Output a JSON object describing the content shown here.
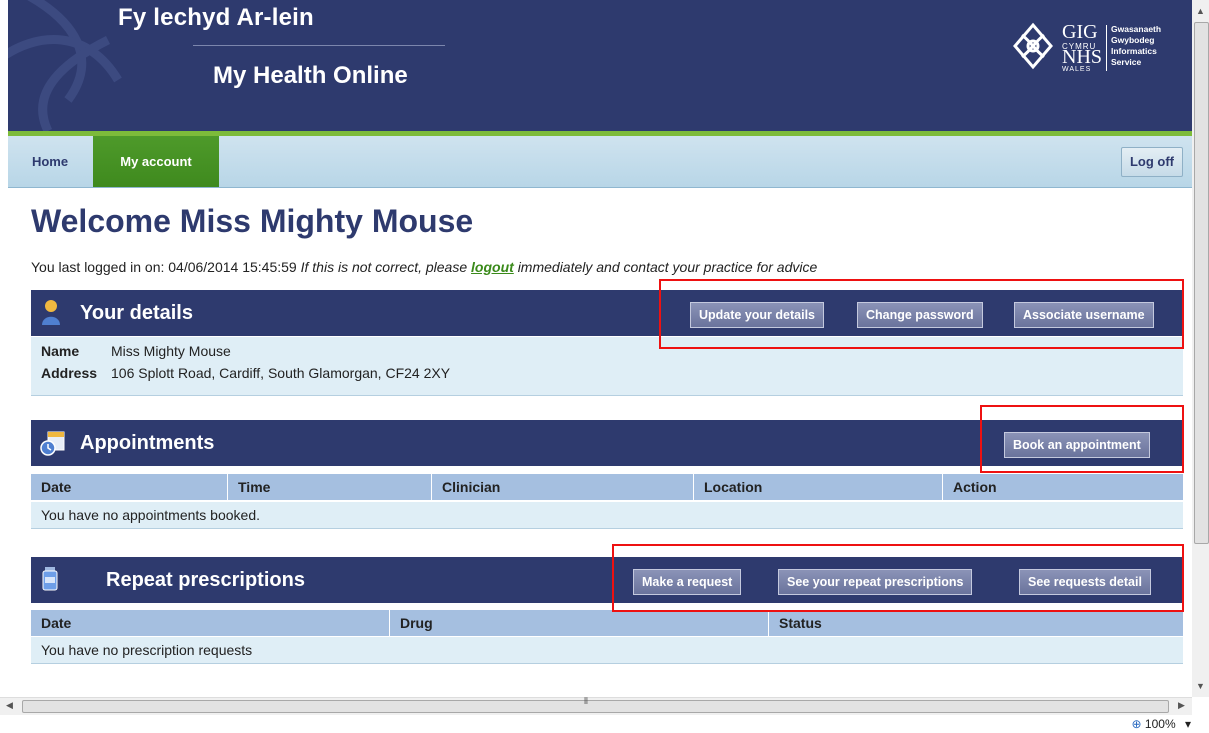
{
  "header": {
    "title_cy": "Fy lechyd Ar-lein",
    "title_en": "My Health Online",
    "logo": {
      "gig": "GIG",
      "cymru": "CYMRU",
      "nhs": "NHS",
      "wales": "WALES",
      "service_lines": [
        "Gwasanaeth",
        "Gwybodeg",
        "Informatics",
        "Service"
      ]
    }
  },
  "nav": {
    "tabs": [
      {
        "label": "Home",
        "active": false
      },
      {
        "label": "My account",
        "active": true
      }
    ],
    "logoff_label": "Log off"
  },
  "welcome": "Welcome Miss Mighty Mouse",
  "last_login": {
    "prefix": "You last logged in on: 04/06/2014 15:45:59",
    "notice_before": "If this is not correct, please",
    "logout_link": "logout",
    "notice_after": "immediately and contact your practice for advice"
  },
  "details": {
    "title": "Your details",
    "icon": "person-icon",
    "buttons": [
      "Update your details",
      "Change password",
      "Associate username"
    ],
    "name_label": "Name",
    "name_value": "Miss Mighty Mouse",
    "address_label": "Address",
    "address_value": "106 Splott Road, Cardiff, South Glamorgan, CF24 2XY"
  },
  "appointments": {
    "title": "Appointments",
    "icon": "calendar-clock-icon",
    "button": "Book an appointment",
    "columns": [
      "Date",
      "Time",
      "Clinician",
      "Location",
      "Action"
    ],
    "empty_message": "You have no appointments booked."
  },
  "prescriptions": {
    "title": "Repeat prescriptions",
    "icon": "medicine-bottle-icon",
    "buttons": [
      "Make a request",
      "See your repeat prescriptions",
      "See requests detail"
    ],
    "columns": [
      "Date",
      "Drug",
      "Status"
    ],
    "empty_message": "You have no prescription requests"
  },
  "statusbar": {
    "zoom": "100%"
  },
  "colors": {
    "brand_navy": "#2e3a6e",
    "brand_green": "#4e9a2a",
    "highlight_red": "#ee1111"
  }
}
